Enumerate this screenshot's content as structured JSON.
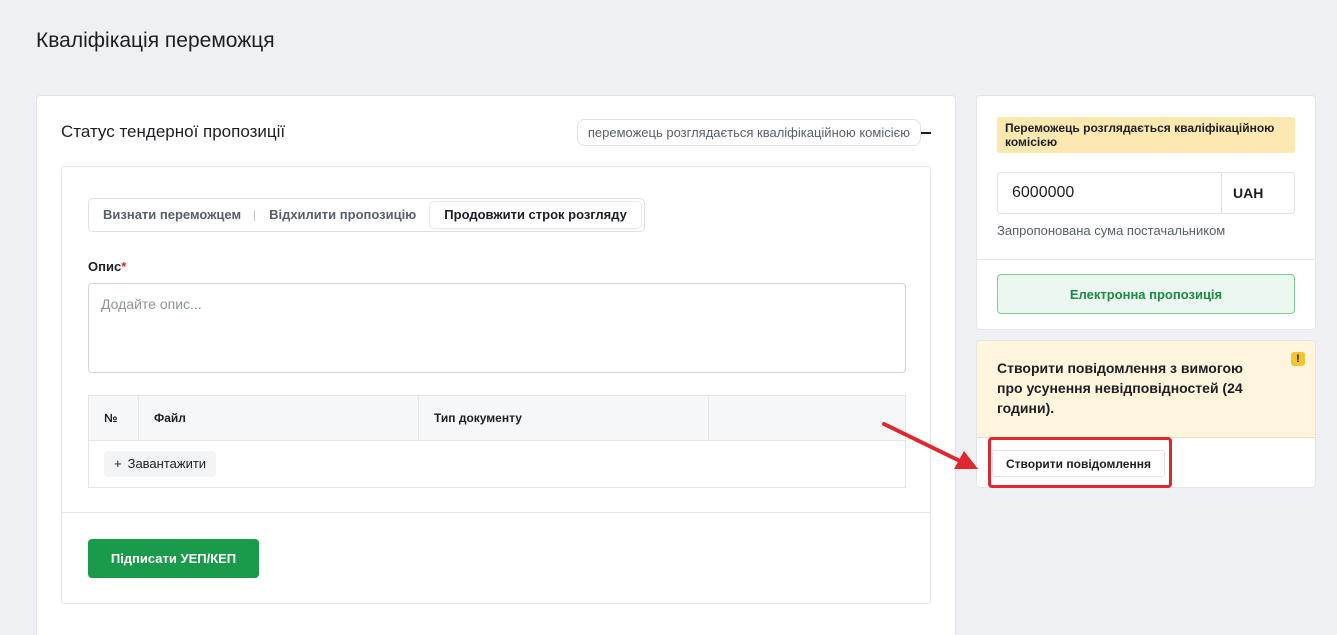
{
  "page": {
    "title": "Кваліфікація переможця"
  },
  "status_card": {
    "title": "Статус тендерної пропозиції",
    "status": "переможець розглядається кваліфікаційною комісією"
  },
  "tabs": [
    {
      "label": "Визнати переможцем",
      "active": false
    },
    {
      "label": "Відхилити пропозицію",
      "active": false
    },
    {
      "label": "Продовжити строк розгляду",
      "active": true
    }
  ],
  "description": {
    "label": "Опис",
    "required_mark": "*",
    "placeholder": "Додайте опис..."
  },
  "files_table": {
    "columns": [
      "№",
      "Файл",
      "Тип документу",
      ""
    ],
    "upload_label": "Завантажити",
    "upload_icon": "+"
  },
  "sign_button": {
    "label": "Підписати УЕП/КЕП"
  },
  "side": {
    "warning_badge": "Переможець розглядається кваліфікаційною комісією",
    "amount": "6000000",
    "currency": "UAH",
    "amount_hint": "Запропонована сума постачальником",
    "e_offer_label": "Електронна пропозиція"
  },
  "notification": {
    "text": "Створити повідомлення з вимогою про усунення невідповідностей (24 години).",
    "icon": "!",
    "button_label": "Створити повідомлення"
  },
  "colors": {
    "primary_green": "#1a9b4b",
    "warning_bg": "#fff4dc",
    "badge_yellow": "#fde9b0",
    "annotation_red": "#e0262e"
  }
}
